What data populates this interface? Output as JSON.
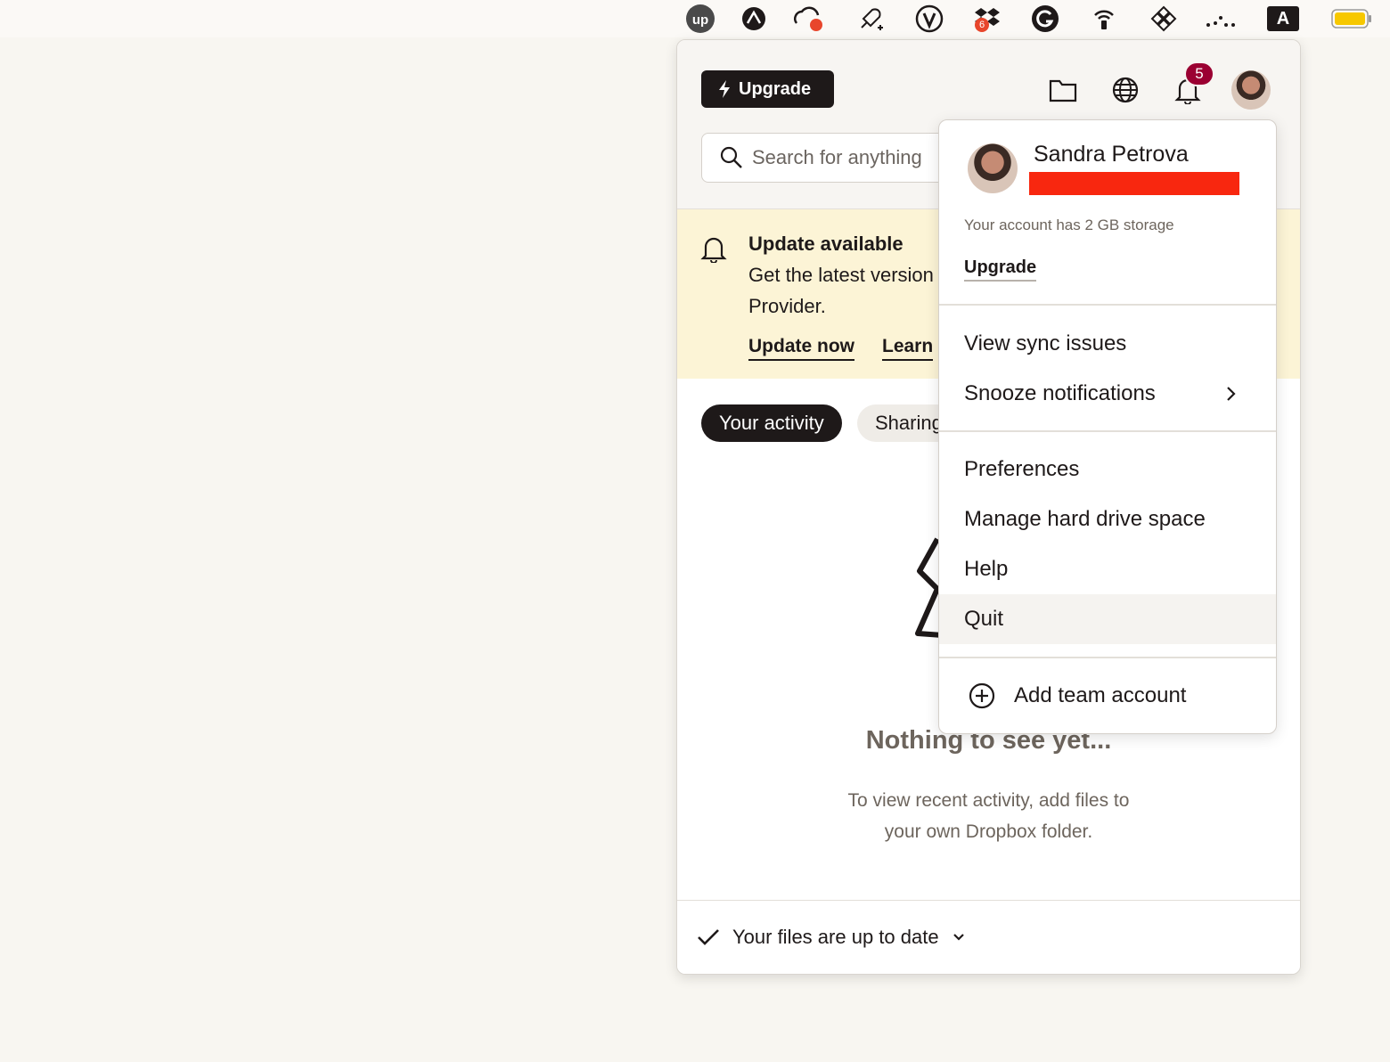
{
  "menubar": {
    "icons": [
      "upwork-icon",
      "sketch-icon",
      "cloud-sync-icon",
      "rocket-icon",
      "tor-icon",
      "dropbox-icon",
      "grammarly-icon",
      "airdrop-icon",
      "slack-icon",
      "dots-icon",
      "keyboard-a-icon",
      "battery-icon"
    ],
    "dropbox_badge": "6",
    "keyboard_label": "A"
  },
  "header": {
    "upgrade_label": "Upgrade",
    "notification_count": "5"
  },
  "search": {
    "placeholder": "Search for anything"
  },
  "banner": {
    "title": "Update available",
    "text": "Get the latest version Provider.",
    "update_now": "Update now",
    "learn": "Learn"
  },
  "tabs": {
    "activity": "Your activity",
    "sharing": "Sharing"
  },
  "empty": {
    "title": "Nothing to see yet...",
    "text": "To view recent activity, add files to your own Dropbox folder."
  },
  "footer": {
    "status": "Your files are up to date"
  },
  "dropdown": {
    "name": "Sandra Petrova",
    "storage": "Your account has 2 GB storage",
    "upgrade": "Upgrade",
    "items": {
      "sync_issues": "View sync issues",
      "snooze": "Snooze notifications",
      "preferences": "Preferences",
      "manage_space": "Manage hard drive space",
      "help": "Help",
      "quit": "Quit",
      "add_team": "Add team account"
    }
  },
  "colors": {
    "accent_dark": "#1e1919",
    "banner_bg": "#fcf4d6",
    "badge": "#9b0032",
    "redaction": "#f8270f"
  }
}
